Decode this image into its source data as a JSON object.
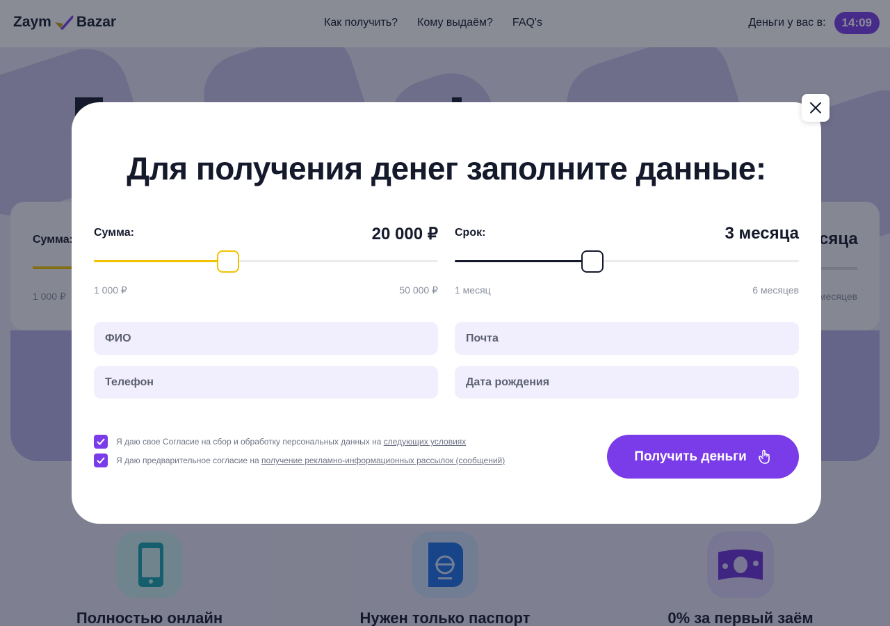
{
  "header": {
    "logo_left": "Zaym",
    "logo_right": "Bazar",
    "nav": [
      "Как получить?",
      "Кому выдаём?",
      "FAQ's"
    ],
    "timer_label": "Деньги у вас в:",
    "timer_value": "14:09"
  },
  "background": {
    "sum_label": "Сумма:",
    "sum_min": "1 000 ₽",
    "term_title_fragment": "сяца",
    "term_max_fragment": "месяцев",
    "features": [
      {
        "title": "Полностью онлайн",
        "icon": "phone-icon"
      },
      {
        "title": "Нужен только паспорт",
        "icon": "passport-icon"
      },
      {
        "title": "0% за первый заём",
        "icon": "banknote-icon"
      }
    ]
  },
  "modal": {
    "title": "Для получения денег заполните данные:",
    "amount": {
      "label": "Сумма:",
      "value": "20 000 ₽",
      "min": "1 000 ₽",
      "max": "50 000 ₽",
      "level": 0.39,
      "color": "#f2c200"
    },
    "term": {
      "label": "Срок:",
      "value": "3 месяца",
      "min": "1 месяц",
      "max": "6 месяцев",
      "level": 0.4,
      "color": "#14192b"
    },
    "fields": {
      "name_placeholder": "ФИО",
      "email_placeholder": "Почта",
      "phone_placeholder": "Телефон",
      "birthdate_placeholder": "Дата рождения"
    },
    "consents": [
      {
        "text": "Я даю свое Согласие на сбор и обработку персональных данных на ",
        "link": "следующих условиях",
        "checked": true
      },
      {
        "text": "Я даю предварительное согласие на ",
        "link": "получение рекламно-информационных рассылок (сообщений)",
        "checked": true
      }
    ],
    "submit_label": "Получить деньги"
  },
  "colors": {
    "accent": "#7a3ce8",
    "dark": "#14192b",
    "yellow": "#f2c200",
    "field_bg": "#f1eefd"
  }
}
